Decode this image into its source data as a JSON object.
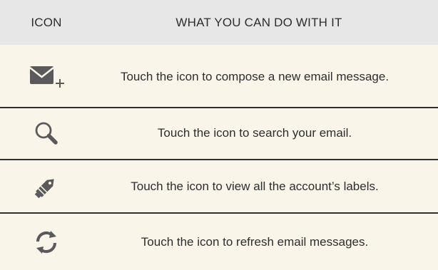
{
  "header": {
    "icon_col": "ICON",
    "desc_col": "WHAT YOU CAN DO WITH IT"
  },
  "rows": [
    {
      "icon": "compose-email-icon",
      "text": "Touch the icon to compose a new email message."
    },
    {
      "icon": "search-icon",
      "text": "Touch the icon to search your email."
    },
    {
      "icon": "label-tag-icon",
      "text": "Touch the icon to view all the account’s labels."
    },
    {
      "icon": "refresh-icon",
      "text": "Touch the icon to refresh email messages."
    }
  ],
  "colors": {
    "icon": "#5a5a5a",
    "header_bg": "#e7e7e7",
    "row_bg": "#f9f6e9",
    "divider": "#2f2f2f"
  }
}
